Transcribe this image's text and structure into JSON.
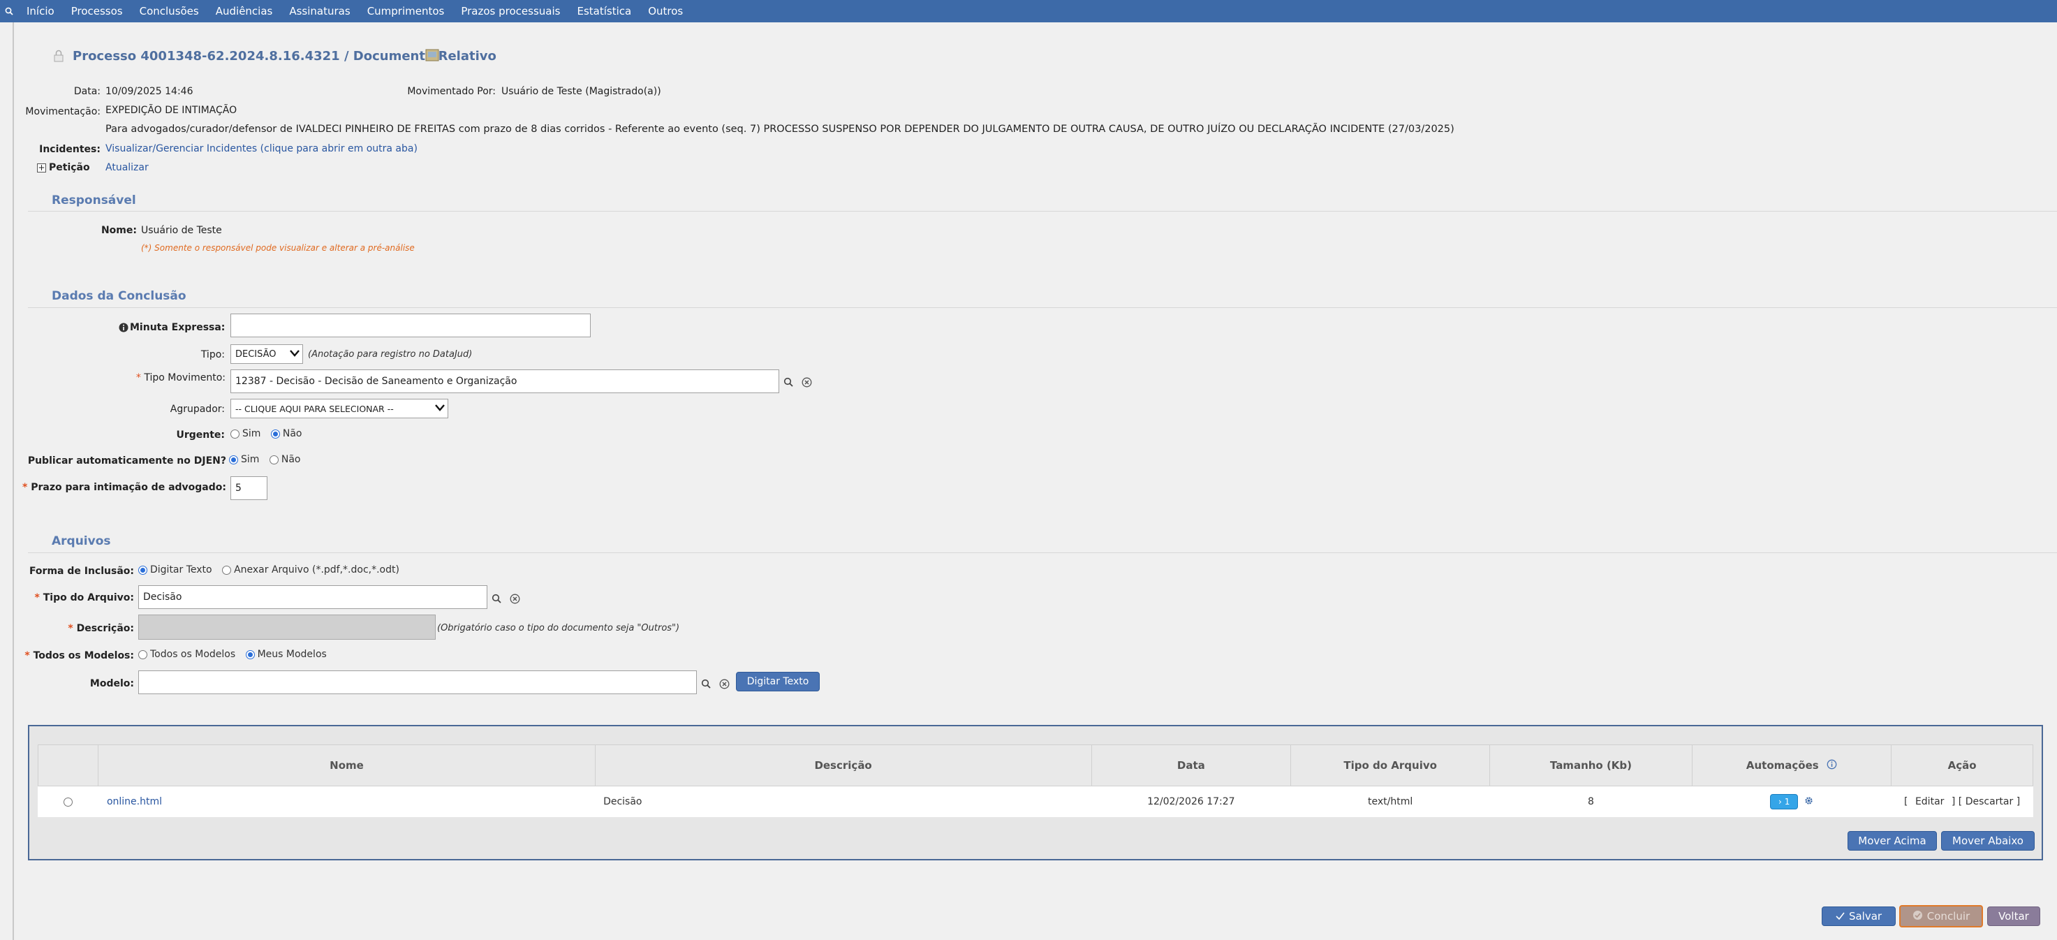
{
  "nav": {
    "items": [
      "Início",
      "Processos",
      "Conclusões",
      "Audiências",
      "Assinaturas",
      "Cumprimentos",
      "Prazos processuais",
      "Estatística",
      "Outros"
    ]
  },
  "header": {
    "title": "Processo 4001348-62.2024.8.16.4321 / Documento Relativo"
  },
  "info": {
    "data_label": "Data:",
    "data_value": "10/09/2025 14:46",
    "movimentado_label": "Movimentado Por:",
    "movimentado_value": "Usuário de Teste (Magistrado(a))",
    "movimentacao_label": "Movimentação:",
    "movimentacao_value": "EXPEDIÇÃO DE INTIMAÇÃO",
    "descricao": "Para advogados/curador/defensor de IVALDECI PINHEIRO DE FREITAS com prazo de 8 dias corridos - Referente ao evento (seq. 7) PROCESSO SUSPENSO POR DEPENDER DO JULGAMENTO DE OUTRA CAUSA, DE OUTRO JUÍZO OU DECLARAÇÃO INCIDENTE (27/03/2025)",
    "incidentes_label": "Incidentes:",
    "incidentes_link": "Visualizar/Gerenciar Incidentes (clique para abrir em outra aba)",
    "peticao_label": "Petição",
    "peticao_link": "Atualizar"
  },
  "responsavel": {
    "title": "Responsável",
    "nome_label": "Nome:",
    "nome_value": "Usuário de Teste",
    "note": "(*) Somente o responsável pode visualizar e alterar a pré-análise"
  },
  "conclusao": {
    "title": "Dados da Conclusão",
    "minuta_label": "Minuta Expressa:",
    "minuta_value": "",
    "tipo_label": "Tipo:",
    "tipo_value": "DECISÃO",
    "tipo_note": "(Anotação para registro no DataJud)",
    "tipo_mov_label": "Tipo Movimento:",
    "tipo_mov_value": "12387 - Decisão - Decisão de Saneamento e Organização",
    "agrupador_label": "Agrupador:",
    "agrupador_value": "-- CLIQUE AQUI PARA SELECIONAR --",
    "urgente_label": "Urgente:",
    "sim": "Sim",
    "nao": "Não",
    "publicar_label": "Publicar automaticamente no DJEN?",
    "prazo_label": "Prazo para intimação de advogado:",
    "prazo_value": "5"
  },
  "arquivos": {
    "title": "Arquivos",
    "forma_label": "Forma de Inclusão:",
    "opt_digitar": "Digitar Texto",
    "opt_anexar": "Anexar Arquivo (*.pdf,*.doc,*.odt)",
    "tipo_arquivo_label": "Tipo do Arquivo:",
    "tipo_arquivo_value": "Decisão",
    "descricao_label": "Descrição:",
    "descricao_note": "(Obrigatório caso o tipo do documento seja \"Outros\")",
    "modelos_label": "Todos os Modelos:",
    "opt_todos": "Todos os Modelos",
    "opt_meus": "Meus Modelos",
    "modelo_label": "Modelo:",
    "modelo_value": "",
    "digitar_btn": "Digitar Texto"
  },
  "table": {
    "headers": [
      "Nome",
      "Descrição",
      "Data",
      "Tipo do Arquivo",
      "Tamanho (Kb)",
      "Automações",
      "Ação"
    ],
    "rows": [
      {
        "nome": "online.html",
        "descricao": "Decisão",
        "data": "12/02/2026 17:27",
        "tipo": "text/html",
        "tamanho": "8",
        "automacoes": "1",
        "acao_editar": "Editar",
        "acao_descartar": "[ Descartar ]"
      }
    ],
    "mover_acima": "Mover Acima",
    "mover_abaixo": "Mover Abaixo"
  },
  "footer": {
    "salvar": "Salvar",
    "concluir": "Concluir",
    "voltar": "Voltar"
  },
  "colors": {
    "nav_bg": "#3d6aa8",
    "section_title": "#5a7bb0",
    "button_blue": "#4a74b4",
    "concluir_bg": "#b0958a",
    "voltar_bg": "#8a7c9a",
    "required": "#e05020"
  }
}
